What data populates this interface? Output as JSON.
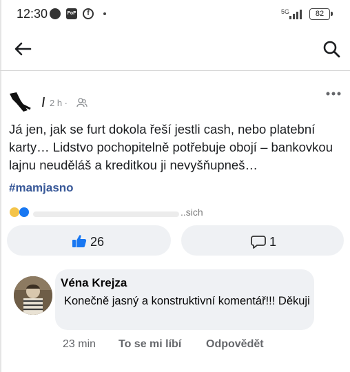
{
  "status_bar": {
    "time": "12:30",
    "fb_shield_text": "FoF",
    "fb_circle_text": "f",
    "network": "5G",
    "battery": "82"
  },
  "header": {
    "back_icon": "arrow-left-icon",
    "search_icon": "search-icon"
  },
  "post": {
    "time": "2 h ·",
    "audience_icon": "friends-icon",
    "more_icon": "more-horizontal-icon",
    "text": "Já jen, jak se furt dokola řeší jestli cash, nebo platební karty… Lidstvo pochopitelně potřebuje obojí – bankovkou lajnu neuděláš a kreditkou ji nevyšňupneš…",
    "hashtag": "#mamjasno",
    "reactions_tail": "..sich"
  },
  "actions": {
    "like_icon": "thumbs-up-icon",
    "like_count": "26",
    "comment_icon": "comment-bubble-icon",
    "comment_count": "1"
  },
  "comment": {
    "author": "Véna Krejza",
    "text": "Konečně jasný a konstruktivní komentář!!! Děkuji",
    "time": "23 min",
    "like_label": "To se mi líbí",
    "reply_label": "Odpovědět"
  },
  "colors": {
    "link": "#385898",
    "pill_bg": "#eff1f4",
    "like_blue": "#1877f2"
  }
}
